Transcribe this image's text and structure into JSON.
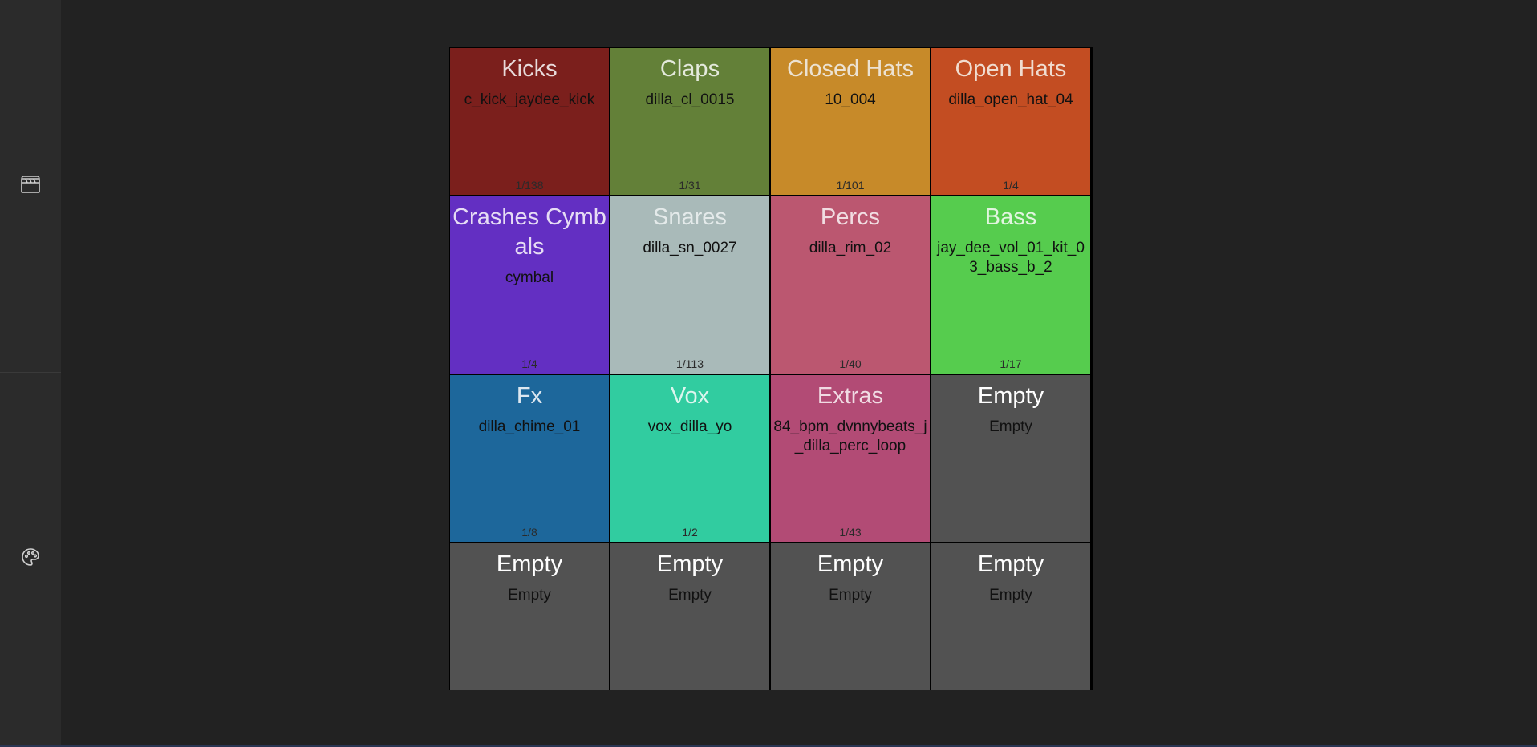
{
  "sidebar": {
    "items": [
      {
        "icon": "clapperboard-icon"
      },
      {
        "icon": "palette-icon"
      }
    ]
  },
  "pads": [
    {
      "title": "Kicks",
      "sample": "c_kick_jaydee_kick",
      "count": "1/138",
      "color": "#7b1f1c",
      "title_color": "#e8dada"
    },
    {
      "title": "Claps",
      "sample": "dilla_cl_0015",
      "count": "1/31",
      "color": "#638038",
      "title_color": "#e4e9dc"
    },
    {
      "title": "Closed Hats",
      "sample": "10_004",
      "count": "1/101",
      "color": "#c78a29",
      "title_color": "#ece2d2"
    },
    {
      "title": "Open Hats",
      "sample": "dilla_open_hat_04",
      "count": "1/4",
      "color": "#c34d22",
      "title_color": "#f0dccf"
    },
    {
      "title": "Crashes Cymbals",
      "sample": "cymbal",
      "count": "1/4",
      "color": "#632fc2",
      "title_color": "#e6dcf4"
    },
    {
      "title": "Snares",
      "sample": "dilla_sn_0027",
      "count": "1/113",
      "color": "#a9bab9",
      "title_color": "#e4eaea"
    },
    {
      "title": "Percs",
      "sample": "dilla_rim_02",
      "count": "1/40",
      "color": "#bb5770",
      "title_color": "#f1dde2"
    },
    {
      "title": "Bass",
      "sample": "jay_dee_vol_01_kit_03_bass_b_2",
      "count": "1/17",
      "color": "#56cc4e",
      "title_color": "#e2f5e0"
    },
    {
      "title": "Fx",
      "sample": "dilla_chime_01",
      "count": "1/8",
      "color": "#1d679b",
      "title_color": "#dde7f0"
    },
    {
      "title": "Vox",
      "sample": "vox_dilla_yo",
      "count": "1/2",
      "color": "#31cca0",
      "title_color": "#dcf5ee"
    },
    {
      "title": "Extras",
      "sample": "84_bpm_dvnnybeats_j_dilla_perc_loop",
      "count": "1/43",
      "color": "#b24b75",
      "title_color": "#f0dbe3"
    },
    {
      "title": "Empty",
      "sample": "Empty",
      "count": "",
      "color": "#525252",
      "title_color": "#ffffff"
    },
    {
      "title": "Empty",
      "sample": "Empty",
      "count": "",
      "color": "#525252",
      "title_color": "#ffffff"
    },
    {
      "title": "Empty",
      "sample": "Empty",
      "count": "",
      "color": "#525252",
      "title_color": "#ffffff"
    },
    {
      "title": "Empty",
      "sample": "Empty",
      "count": "",
      "color": "#525252",
      "title_color": "#ffffff"
    },
    {
      "title": "Empty",
      "sample": "Empty",
      "count": "",
      "color": "#525252",
      "title_color": "#ffffff"
    }
  ]
}
